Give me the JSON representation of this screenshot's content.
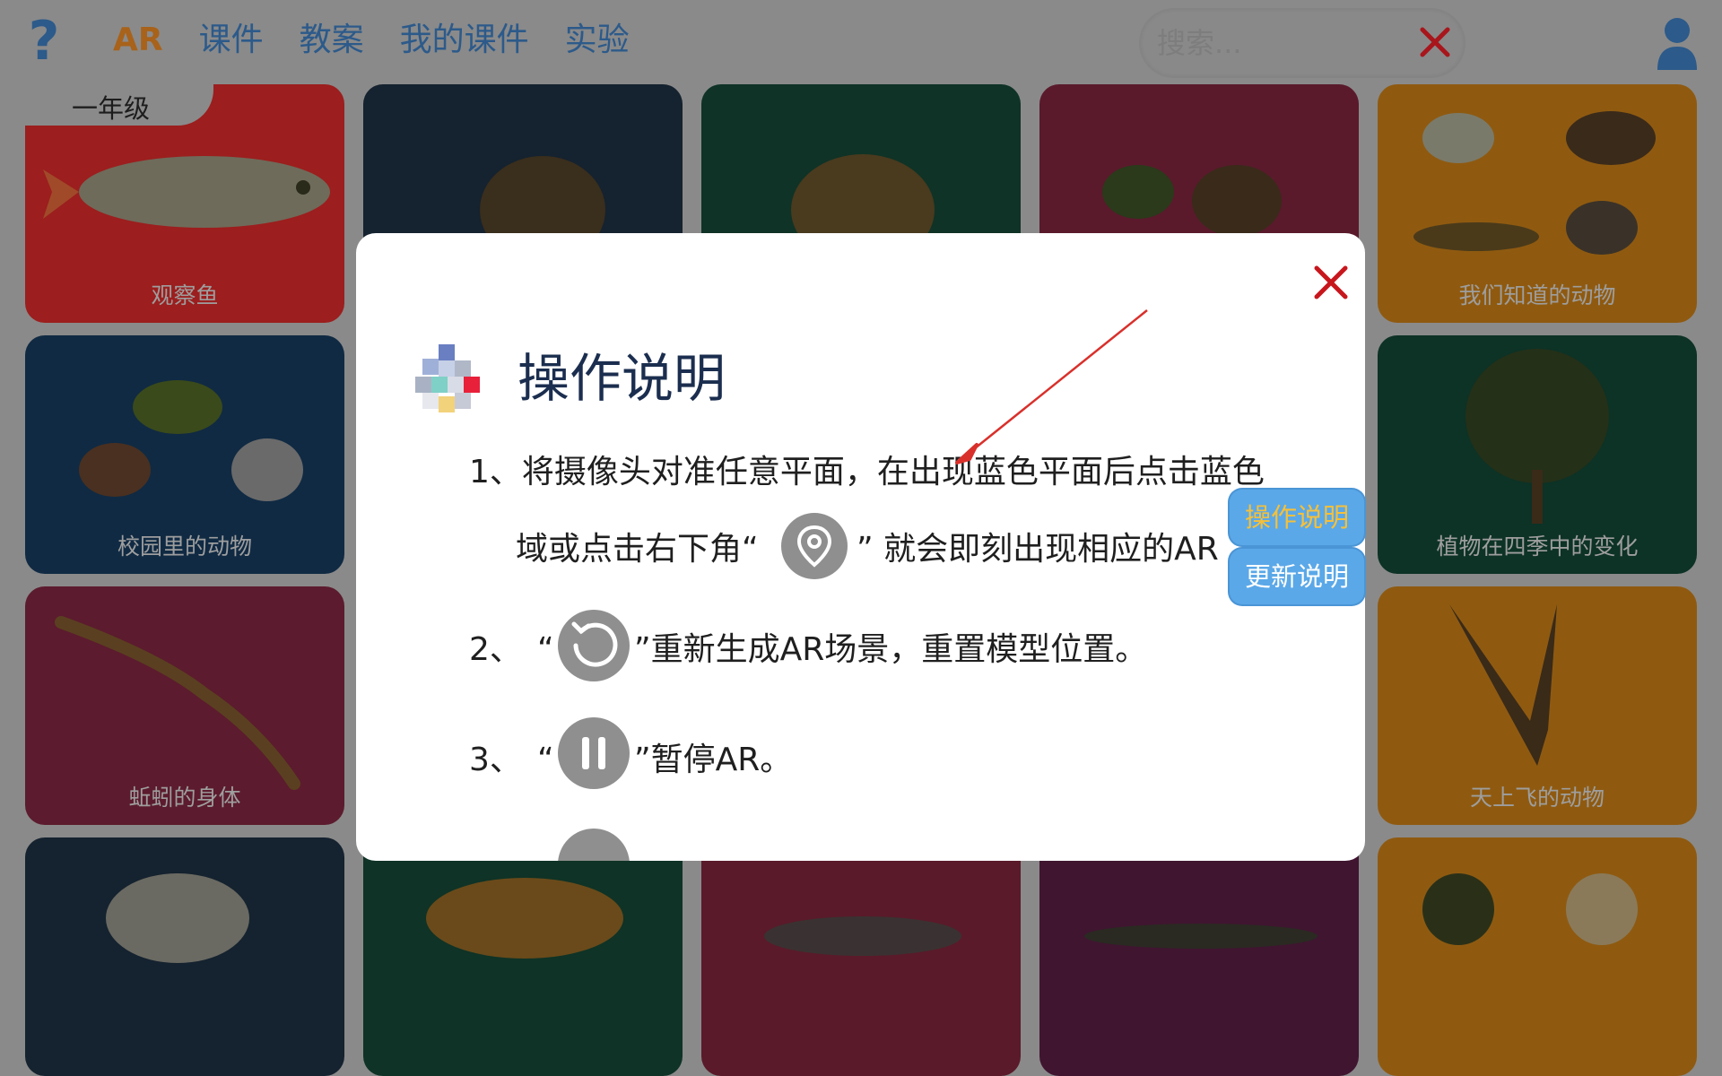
{
  "nav": {
    "items": [
      "AR",
      "课件",
      "教案",
      "我的课件",
      "实验"
    ],
    "active_index": 0
  },
  "search": {
    "placeholder": "搜索..."
  },
  "grade_tab": "一年级",
  "cards": [
    {
      "label": "观察鱼",
      "bg": "#b02020"
    },
    {
      "label": "",
      "bg": "#1a2b3c"
    },
    {
      "label": "",
      "bg": "#103d2e"
    },
    {
      "label": "",
      "bg": "#6b1a33"
    },
    {
      "label": "我们知道的动物",
      "bg": "#a86a10"
    },
    {
      "label": "校园里的动物",
      "bg": "#12314f"
    },
    {
      "label": "植物在四季中的变化",
      "bg": "#0f3a2d"
    },
    {
      "label": "蚯蚓的身体",
      "bg": "#6b1f33"
    },
    {
      "label": "天上飞的动物",
      "bg": "#a86a10"
    },
    {
      "label": "",
      "bg": "#1a2b3c"
    },
    {
      "label": "",
      "bg": "#103d2e"
    },
    {
      "label": "",
      "bg": "#6b1a33"
    },
    {
      "label": "",
      "bg": "#4a1a3a"
    },
    {
      "label": "",
      "bg": "#a86a10"
    }
  ],
  "dialog": {
    "title": "操作说明",
    "step1_line1": "1、将摄像头对准任意平面，在出现蓝色平面后点击蓝色",
    "step1_line2_a": "域或点击右下角“",
    "step1_line2_b": "”  就会即刻出现相应的AR",
    "step2_num": "2、",
    "step2_open": "“",
    "step2_text": "”重新生成AR场景，重置模型位置。",
    "step3_num": "3、",
    "step3_open": "“",
    "step3_text": "”暂停AR。"
  },
  "side_buttons": {
    "instructions": "操作说明",
    "update_notes": "更新说明"
  },
  "colors": {
    "accent_blue": "#5aa8e8",
    "nav_blue": "#2c5a8a",
    "nav_active": "#a8621a",
    "close_red": "#c8161d",
    "arrow_red": "#d9302b"
  },
  "icons": [
    "help-icon",
    "close-icon",
    "user-icon",
    "location-pin-icon",
    "reset-icon",
    "pause-icon",
    "cube-logo-icon"
  ]
}
